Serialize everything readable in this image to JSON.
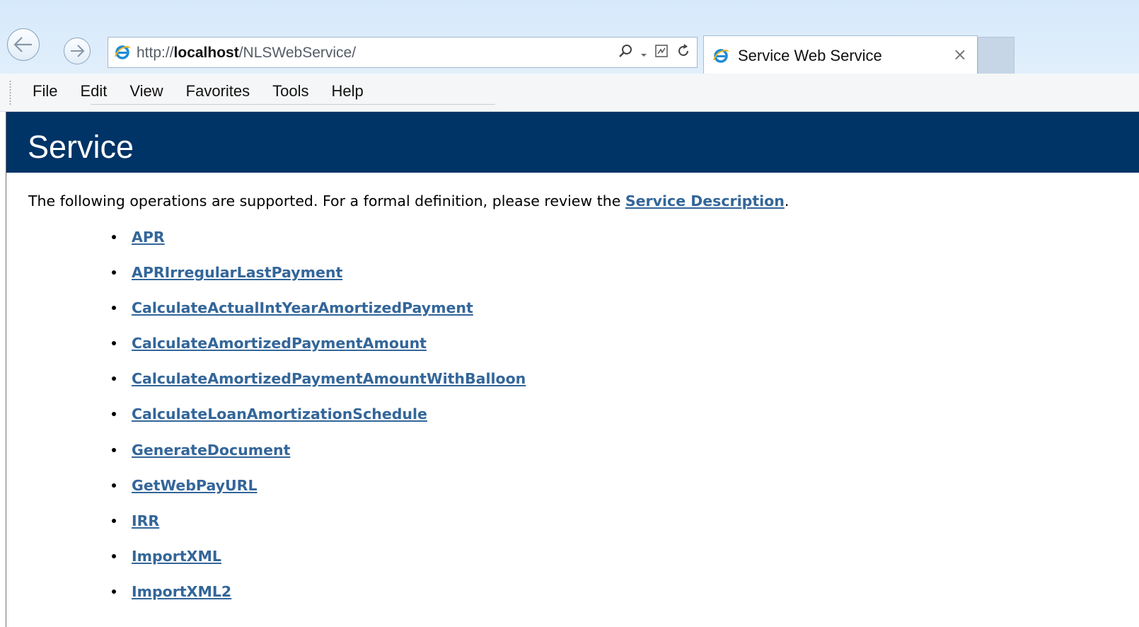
{
  "browser": {
    "url_prefix": "http://",
    "url_host": "localhost",
    "url_path": "/NLSWebService/",
    "tab_title": "Service Web Service",
    "tab_close": "×",
    "menu": [
      "File",
      "Edit",
      "View",
      "Favorites",
      "Tools",
      "Help"
    ],
    "icons": {
      "back": "back-arrow-icon",
      "forward": "forward-arrow-icon",
      "search": "search-icon",
      "compat": "compatibility-view-icon",
      "refresh": "refresh-icon",
      "page_favicon": "internet-explorer-icon"
    }
  },
  "page": {
    "title": "Service",
    "intro_text": "The following operations are supported. For a formal definition, please review the ",
    "intro_link": "Service Description",
    "intro_end": ".",
    "operations": [
      "APR",
      "APRIrregularLastPayment",
      "CalculateActualIntYearAmortizedPayment",
      "CalculateAmortizedPaymentAmount",
      "CalculateAmortizedPaymentAmountWithBalloon",
      "CalculateLoanAmortizationSchedule",
      "GenerateDocument",
      "GetWebPayURL",
      "IRR",
      "ImportXML",
      "ImportXML2"
    ]
  },
  "colors": {
    "header_bg": "#003366",
    "link": "#336699",
    "chrome": "#d6e9fb"
  }
}
